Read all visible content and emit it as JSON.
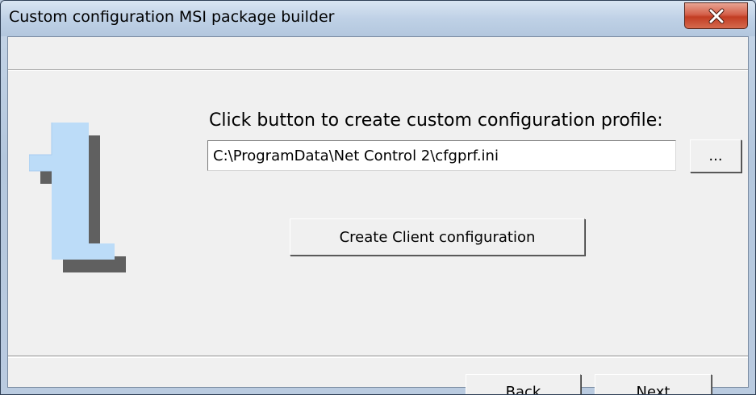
{
  "window": {
    "title": "Custom configuration MSI package builder",
    "close_icon": "close-x-icon"
  },
  "step": {
    "number": "1",
    "prompt": "Click button to create custom configuration profile:"
  },
  "config_path": {
    "value": "C:\\ProgramData\\Net Control 2\\cfgprf.ini"
  },
  "buttons": {
    "browse_label": "...",
    "create_label": "Create Client configuration",
    "back_label": "Back",
    "next_label": "Next"
  },
  "colors": {
    "close_button": "#c8452b",
    "digit_fill": "#bcdcf8",
    "digit_shadow": "#606060"
  }
}
